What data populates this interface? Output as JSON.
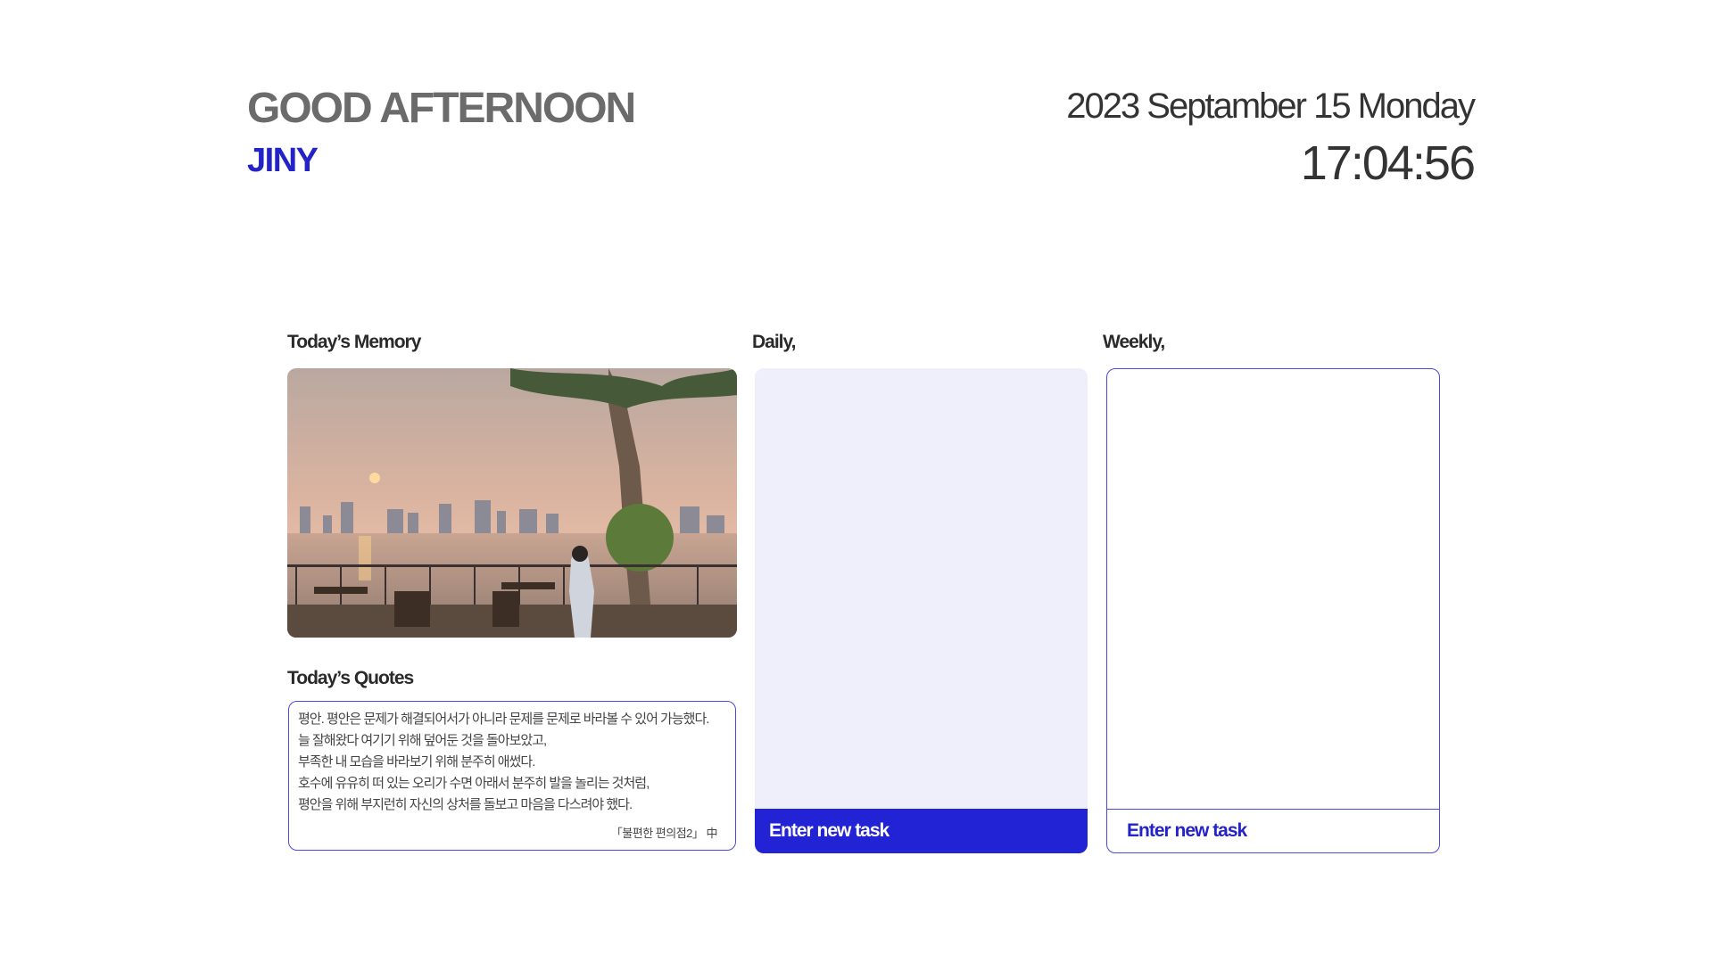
{
  "header": {
    "greeting": "GOOD AFTERNOON",
    "username": "JINY",
    "date": "2023 Septamber 15 Monday",
    "time": "17:04:56"
  },
  "memory": {
    "title": "Today’s Memory",
    "photo_description_icon": "sunset-cityscape-photo"
  },
  "quotes": {
    "title": "Today’s Quotes",
    "lines": [
      "평안. 평안은 문제가 해결되어서가 아니라 문제를 문제로 바라볼 수 있어 가능했다.",
      "늘 잘해왔다 여기기 위해 덮어둔 것을 돌아보았고,",
      "부족한 내 모습을 바라보기 위해 분주히 애썼다.",
      "호수에 유유히 떠 있는 오리가 수면 아래서 분주히 발을 놀리는 것처럼,",
      "평안을 위해 부지런히 자신의 상처를 돌보고 마음을 다스려야 했다."
    ],
    "source": "「불편한 편의점2」 中"
  },
  "daily": {
    "title": "Daily,",
    "input_placeholder": "Enter new task"
  },
  "weekly": {
    "title": "Weekly,",
    "input_placeholder": "Enter new task"
  },
  "colors": {
    "accent": "#2323d6",
    "daily_bg": "#efeefb",
    "greeting": "#6b6b6b"
  }
}
